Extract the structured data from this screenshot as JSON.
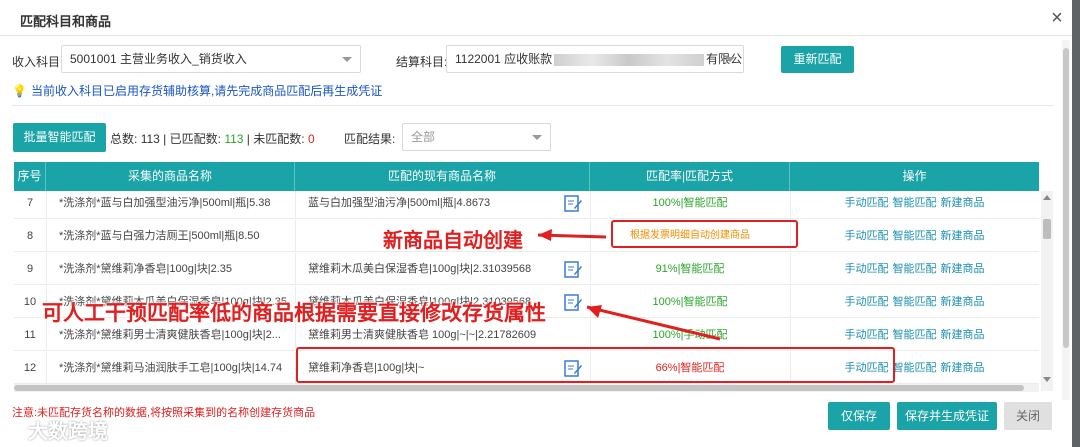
{
  "dialog": {
    "title": "匹配科目和商品",
    "close_label": "×"
  },
  "filters": {
    "income_label": "收入科目:",
    "income_value": "5001001 主营业务收入_销货收入",
    "settle_label": "结算科目:",
    "settle_value_prefix": "1122001 应收账款",
    "settle_value_suffix": "有限公司",
    "rematch_button": "重新匹配"
  },
  "tip": {
    "text": "当前收入科目已启用存货辅助核算,请先完成商品匹配后再生成凭证"
  },
  "toolbar": {
    "batch_button": "批量智能匹配",
    "total_label": "总数:",
    "total_value": "113",
    "matched_label": "| 已匹配数:",
    "matched_value": "113",
    "unmatched_label": "| 未匹配数:",
    "unmatched_value": "0",
    "result_label": "匹配结果:",
    "result_value": "全部"
  },
  "table": {
    "columns": [
      "序号",
      "采集的商品名称",
      "匹配的现有商品名称",
      "匹配率|匹配方式",
      "操作"
    ],
    "rows": [
      {
        "no": "7",
        "source": "*洗涤剂*蓝与白加强型油污净|500ml|瓶|5.38",
        "match": "蓝与白加强型油污净|500ml|瓶|4.8673",
        "rate": "100%|智能匹配"
      },
      {
        "no": "8",
        "source": "*洗涤剂*蓝与白强力洁厕王|500ml|瓶|8.50",
        "match": "",
        "rate": "根据发票明细自动创建商品"
      },
      {
        "no": "9",
        "source": "*洗涤剂*黛维莉净香皂|100g|块|2.35",
        "match": "黛维莉木瓜美白保湿香皂|100g|块|2.31039568",
        "rate": "91%|智能匹配"
      },
      {
        "no": "10",
        "source": "*洗涤剂*黛维莉木瓜美白保湿香皂|100g|块|2.35",
        "match": "黛维莉木瓜美白保湿香皂|100g|块|2.31039568",
        "rate": "100%|智能匹配"
      },
      {
        "no": "11",
        "source": "*洗涤剂*黛维莉男士清爽健肤香皂|100g|块|2...",
        "match": "黛维莉男士清爽健肤香皂 100g|~|~|2.21782609",
        "rate": "100%|手动匹配"
      },
      {
        "no": "12",
        "source": "*洗涤剂*黛维莉马油润肤手工皂|100g|块|14.74",
        "match": "黛维莉净香皂|100g|块|~",
        "rate": "66%|智能匹配"
      }
    ],
    "ops": [
      "手动匹配",
      "智能匹配",
      "新建商品"
    ]
  },
  "annotations": {
    "new_product": "新商品自动创建",
    "manual_edit": "可人工干预匹配率低的商品根据需要直接修改存货属性"
  },
  "footer": {
    "notice": "注意:未匹配存货名称的数据,将按照采集到的名称创建存货商品",
    "save_button": "仅保存",
    "save_generate_button": "保存并生成凭证",
    "close_button": "关闭"
  },
  "watermark": {
    "text": "大数跨境"
  },
  "colors": {
    "accent": "#1aa4a8",
    "success": "#2aa52a",
    "danger": "#e02020",
    "warning": "#f08c00",
    "link": "#1a8fb0",
    "tip": "#1a56c6"
  }
}
